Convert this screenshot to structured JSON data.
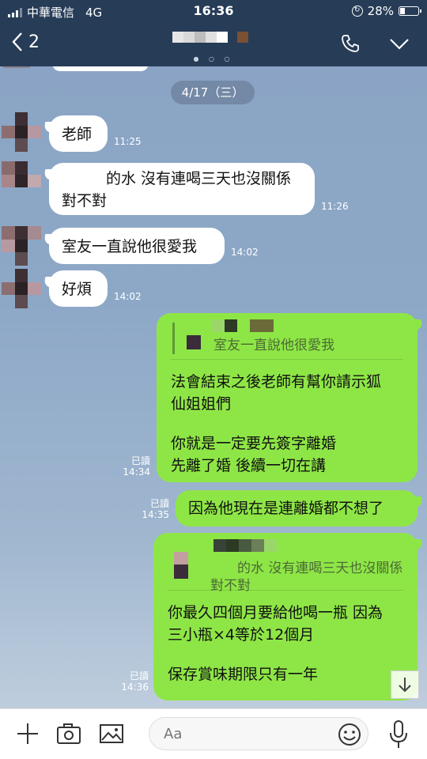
{
  "status_bar": {
    "carrier": "中華電信",
    "network": "4G",
    "time": "16:36",
    "battery_percent": "28%",
    "battery_level": 0.28
  },
  "header": {
    "back_count": "2",
    "page_dots": "● ○ ○",
    "icons": [
      "chevron-left-icon",
      "phone-icon",
      "chevron-down-icon"
    ]
  },
  "chat": {
    "date_label": "4/17（三）",
    "incoming": [
      {
        "lines": [
          "老師"
        ],
        "time": "11:25"
      },
      {
        "lines": [
          "的水 沒有連喝三天也沒關係",
          "對不對"
        ],
        "time": "11:26"
      },
      {
        "lines": [
          "室友一直說他很愛我"
        ],
        "time": "14:02"
      },
      {
        "lines": [
          "好煩"
        ],
        "time": "14:02"
      }
    ],
    "outgoing": [
      {
        "quote": "室友一直說他很愛我",
        "lines": [
          "法會結束之後老師有幫你請示狐",
          "仙姐姐們",
          "",
          "你就是一定要先簽字離婚",
          "先離了婚 後續一切在講"
        ],
        "read": "已讀",
        "time": "14:34"
      },
      {
        "lines": [
          "因為他現在是連離婚都不想了"
        ],
        "read": "已讀",
        "time": "14:35"
      },
      {
        "quote_lines": [
          "的水 沒有連喝三天也沒關係",
          "對不對"
        ],
        "lines": [
          "你最久四個月要給他喝一瓶 因為",
          "三小瓶×4等於12個月",
          "",
          "保存賞味期限只有一年"
        ],
        "read": "已讀",
        "time": "14:36"
      }
    ]
  },
  "input_bar": {
    "placeholder": "Aa",
    "icons": [
      "plus-icon",
      "camera-icon",
      "image-icon",
      "emoji-icon",
      "microphone-icon"
    ]
  },
  "colors": {
    "header_bg": "#263c57",
    "outgoing_bubble": "#8ee646",
    "incoming_bubble": "#ffffff",
    "date_pill": "#7489a6"
  }
}
